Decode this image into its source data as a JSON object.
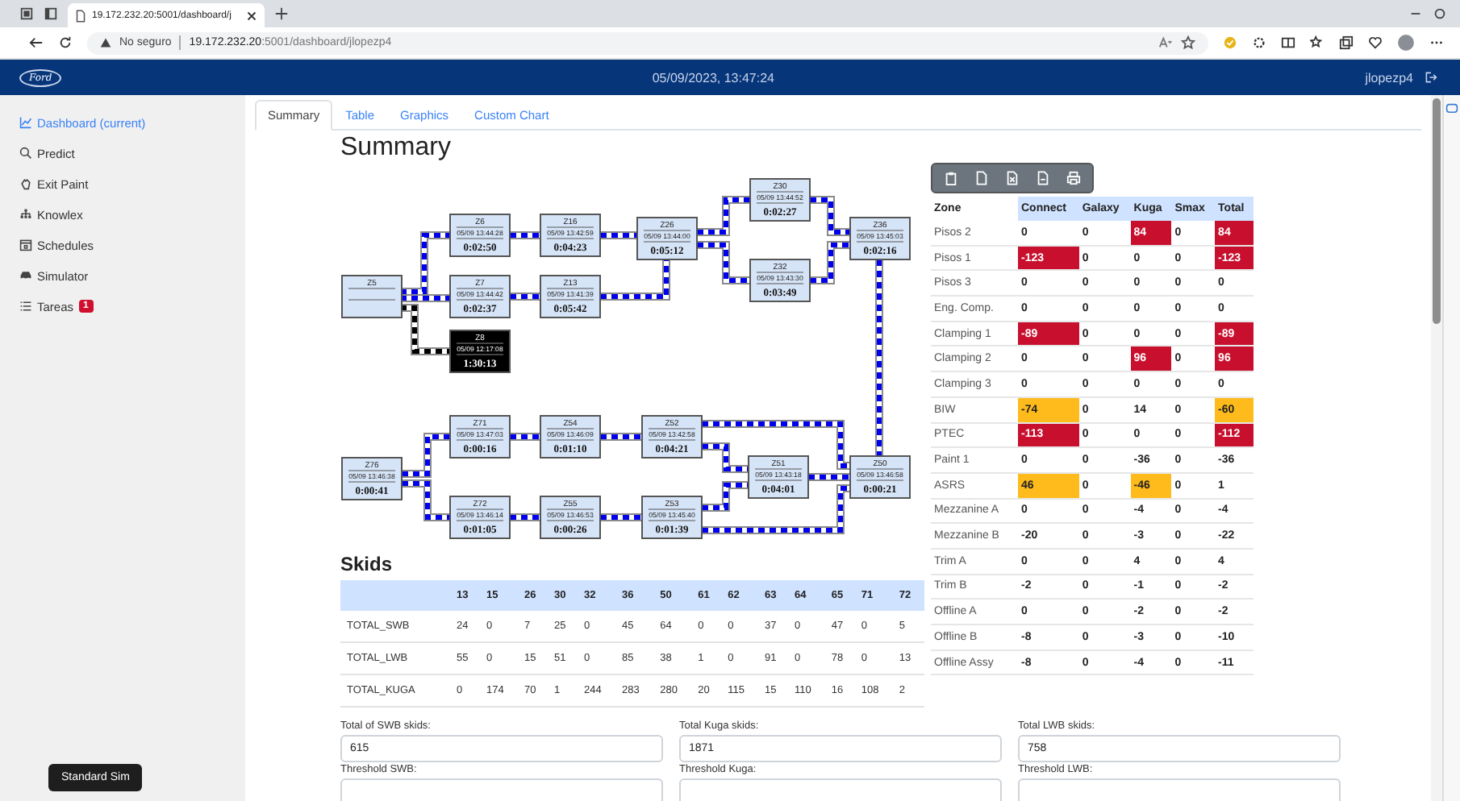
{
  "browser": {
    "tab_title": "19.172.232.20:5001/dashboard/j",
    "security": "No seguro",
    "url_host": "19.172.232.20",
    "url_rest": ":5001/dashboard/jlopezp4"
  },
  "header": {
    "logo": "Ford",
    "datetime": "05/09/2023, 13:47:24",
    "user": "jlopezp4"
  },
  "sidebar": {
    "items": [
      {
        "label": "Dashboard (current)",
        "selected": true
      },
      {
        "label": "Predict",
        "selected": false
      },
      {
        "label": "Exit Paint",
        "selected": false
      },
      {
        "label": "Knowlex",
        "selected": false
      },
      {
        "label": "Schedules",
        "selected": false
      },
      {
        "label": "Simulator",
        "selected": false
      },
      {
        "label": "Tareas",
        "selected": false,
        "badge": "1"
      }
    ]
  },
  "sim_button": "Standard Sim",
  "tabs": [
    {
      "label": "Summary",
      "selected": true
    },
    {
      "label": "Table",
      "selected": false
    },
    {
      "label": "Graphics",
      "selected": false
    },
    {
      "label": "Custom Chart",
      "selected": false
    }
  ],
  "summary": {
    "title": "Summary",
    "nodes": [
      {
        "name": "Z5",
        "kind": "normal"
      },
      {
        "name": "Z6",
        "time": "05/09 13:44:28",
        "duration": "0:02:50",
        "kind": "normal"
      },
      {
        "name": "Z7",
        "time": "05/09 13:44:42",
        "duration": "0:02:37",
        "kind": "normal"
      },
      {
        "name": "Z8",
        "time": "05/09 12:17:08",
        "duration": "1:30:13",
        "kind": "alert"
      },
      {
        "name": "Z16",
        "time": "05/09 13:42:59",
        "duration": "0:04:23",
        "kind": "normal"
      },
      {
        "name": "Z13",
        "time": "05/09 13:41:39",
        "duration": "0:05:42",
        "kind": "normal"
      },
      {
        "name": "Z26",
        "time": "05/09 13:44:00",
        "duration": "0:05:12",
        "kind": "normal"
      },
      {
        "name": "Z30",
        "time": "05/09 13:44:52",
        "duration": "0:02:27",
        "kind": "normal"
      },
      {
        "name": "Z32",
        "time": "05/09 13:43:30",
        "duration": "0:03:49",
        "kind": "normal"
      },
      {
        "name": "Z36",
        "time": "05/09 13:45:03",
        "duration": "0:02:16",
        "kind": "normal"
      },
      {
        "name": "Z76",
        "time": "05/09 13:46:38",
        "duration": "0:00:41",
        "kind": "normal"
      },
      {
        "name": "Z71",
        "time": "05/09 13:47:03",
        "duration": "0:00:16",
        "kind": "normal"
      },
      {
        "name": "Z72",
        "time": "05/09 13:46:14",
        "duration": "0:01:05",
        "kind": "normal"
      },
      {
        "name": "Z54",
        "time": "05/09 13:46:09",
        "duration": "0:01:10",
        "kind": "normal"
      },
      {
        "name": "Z55",
        "time": "05/09 13:46:53",
        "duration": "0:00:26",
        "kind": "normal"
      },
      {
        "name": "Z52",
        "time": "05/09 13:42:58",
        "duration": "0:04:21",
        "kind": "normal"
      },
      {
        "name": "Z53",
        "time": "05/09 13:45:40",
        "duration": "0:01:39",
        "kind": "normal"
      },
      {
        "name": "Z51",
        "time": "05/09 13:43:18",
        "duration": "0:04:01",
        "kind": "normal"
      },
      {
        "name": "Z50",
        "time": "05/09 13:46:58",
        "duration": "0:00:21",
        "kind": "normal"
      }
    ]
  },
  "skids": {
    "title": "Skids",
    "columns": [
      "",
      "13",
      "15",
      "26",
      "30",
      "32",
      "36",
      "50",
      "61",
      "62",
      "63",
      "64",
      "65",
      "71",
      "72"
    ],
    "rows": [
      [
        "TOTAL_SWB",
        "24",
        "0",
        "7",
        "25",
        "0",
        "45",
        "64",
        "0",
        "0",
        "37",
        "0",
        "47",
        "0",
        "5"
      ],
      [
        "TOTAL_LWB",
        "55",
        "0",
        "15",
        "51",
        "0",
        "85",
        "38",
        "1",
        "0",
        "91",
        "0",
        "78",
        "0",
        "13"
      ],
      [
        "TOTAL_KUGA",
        "0",
        "174",
        "70",
        "1",
        "244",
        "283",
        "280",
        "20",
        "115",
        "15",
        "110",
        "16",
        "108",
        "2"
      ]
    ]
  },
  "zones": {
    "columns": [
      "Zone",
      "Connect",
      "Galaxy",
      "Kuga",
      "Smax",
      "Total"
    ],
    "rows": [
      {
        "cells": [
          {
            "value": "Pisos 2"
          },
          {
            "value": "0"
          },
          {
            "value": "0"
          },
          {
            "value": "84",
            "color": "#c8102e"
          },
          {
            "value": "0"
          },
          {
            "value": "84",
            "color": "#c8102e"
          }
        ]
      },
      {
        "cells": [
          {
            "value": "Pisos 1"
          },
          {
            "value": "-123",
            "color": "#c8102e"
          },
          {
            "value": "0"
          },
          {
            "value": "0"
          },
          {
            "value": "0"
          },
          {
            "value": "-123",
            "color": "#c8102e"
          }
        ]
      },
      {
        "cells": [
          {
            "value": "Pisos 3"
          },
          {
            "value": "0"
          },
          {
            "value": "0"
          },
          {
            "value": "0"
          },
          {
            "value": "0"
          },
          {
            "value": "0"
          }
        ]
      },
      {
        "cells": [
          {
            "value": "Eng. Comp."
          },
          {
            "value": "0"
          },
          {
            "value": "0"
          },
          {
            "value": "0"
          },
          {
            "value": "0"
          },
          {
            "value": "0"
          }
        ]
      },
      {
        "cells": [
          {
            "value": "Clamping 1"
          },
          {
            "value": "-89",
            "color": "#c8102e"
          },
          {
            "value": "0"
          },
          {
            "value": "0"
          },
          {
            "value": "0"
          },
          {
            "value": "-89",
            "color": "#c8102e"
          }
        ]
      },
      {
        "cells": [
          {
            "value": "Clamping 2"
          },
          {
            "value": "0"
          },
          {
            "value": "0"
          },
          {
            "value": "96",
            "color": "#c8102e"
          },
          {
            "value": "0"
          },
          {
            "value": "96",
            "color": "#c8102e"
          }
        ]
      },
      {
        "cells": [
          {
            "value": "Clamping 3"
          },
          {
            "value": "0"
          },
          {
            "value": "0"
          },
          {
            "value": "0"
          },
          {
            "value": "0"
          },
          {
            "value": "0"
          }
        ]
      },
      {
        "cells": [
          {
            "value": "BIW"
          },
          {
            "value": "-74",
            "color": "#ffbb1c"
          },
          {
            "value": "0"
          },
          {
            "value": "14"
          },
          {
            "value": "0"
          },
          {
            "value": "-60",
            "color": "#ffbb1c"
          }
        ]
      },
      {
        "cells": [
          {
            "value": "PTEC"
          },
          {
            "value": "-113",
            "color": "#c8102e"
          },
          {
            "value": "0"
          },
          {
            "value": "0"
          },
          {
            "value": "0"
          },
          {
            "value": "-112",
            "color": "#c8102e"
          }
        ]
      },
      {
        "cells": [
          {
            "value": "Paint 1"
          },
          {
            "value": "0"
          },
          {
            "value": "0"
          },
          {
            "value": "-36"
          },
          {
            "value": "0"
          },
          {
            "value": "-36"
          }
        ]
      },
      {
        "cells": [
          {
            "value": "ASRS"
          },
          {
            "value": "46",
            "color": "#ffbb1c"
          },
          {
            "value": "0"
          },
          {
            "value": "-46",
            "color": "#ffbb1c"
          },
          {
            "value": "0"
          },
          {
            "value": "1"
          }
        ]
      },
      {
        "cells": [
          {
            "value": "Mezzanine A"
          },
          {
            "value": "0"
          },
          {
            "value": "0"
          },
          {
            "value": "-4"
          },
          {
            "value": "0"
          },
          {
            "value": "-4"
          }
        ]
      },
      {
        "cells": [
          {
            "value": "Mezzanine B"
          },
          {
            "value": "-20"
          },
          {
            "value": "0"
          },
          {
            "value": "-3"
          },
          {
            "value": "0"
          },
          {
            "value": "-22"
          }
        ]
      },
      {
        "cells": [
          {
            "value": "Trim A"
          },
          {
            "value": "0"
          },
          {
            "value": "0"
          },
          {
            "value": "4"
          },
          {
            "value": "0"
          },
          {
            "value": "4"
          }
        ]
      },
      {
        "cells": [
          {
            "value": "Trim B"
          },
          {
            "value": "-2"
          },
          {
            "value": "0"
          },
          {
            "value": "-1"
          },
          {
            "value": "0"
          },
          {
            "value": "-2"
          }
        ]
      },
      {
        "cells": [
          {
            "value": "Offline A"
          },
          {
            "value": "0"
          },
          {
            "value": "0"
          },
          {
            "value": "-2"
          },
          {
            "value": "0"
          },
          {
            "value": "-2"
          }
        ]
      },
      {
        "cells": [
          {
            "value": "Offline B"
          },
          {
            "value": "-8"
          },
          {
            "value": "0"
          },
          {
            "value": "-3"
          },
          {
            "value": "0"
          },
          {
            "value": "-10"
          }
        ]
      },
      {
        "cells": [
          {
            "value": "Offline Assy"
          },
          {
            "value": "-8"
          },
          {
            "value": "0"
          },
          {
            "value": "-4"
          },
          {
            "value": "0"
          },
          {
            "value": "-11"
          }
        ]
      }
    ]
  },
  "totals": [
    {
      "label": "Total of SWB skids:",
      "value": "615"
    },
    {
      "label": "Total Kuga skids:",
      "value": "1871"
    },
    {
      "label": "Total LWB skids:",
      "value": "758"
    }
  ],
  "thresholds": [
    {
      "label": "Threshold SWB:"
    },
    {
      "label": "Threshold Kuga:"
    },
    {
      "label": "Threshold LWB:"
    }
  ]
}
